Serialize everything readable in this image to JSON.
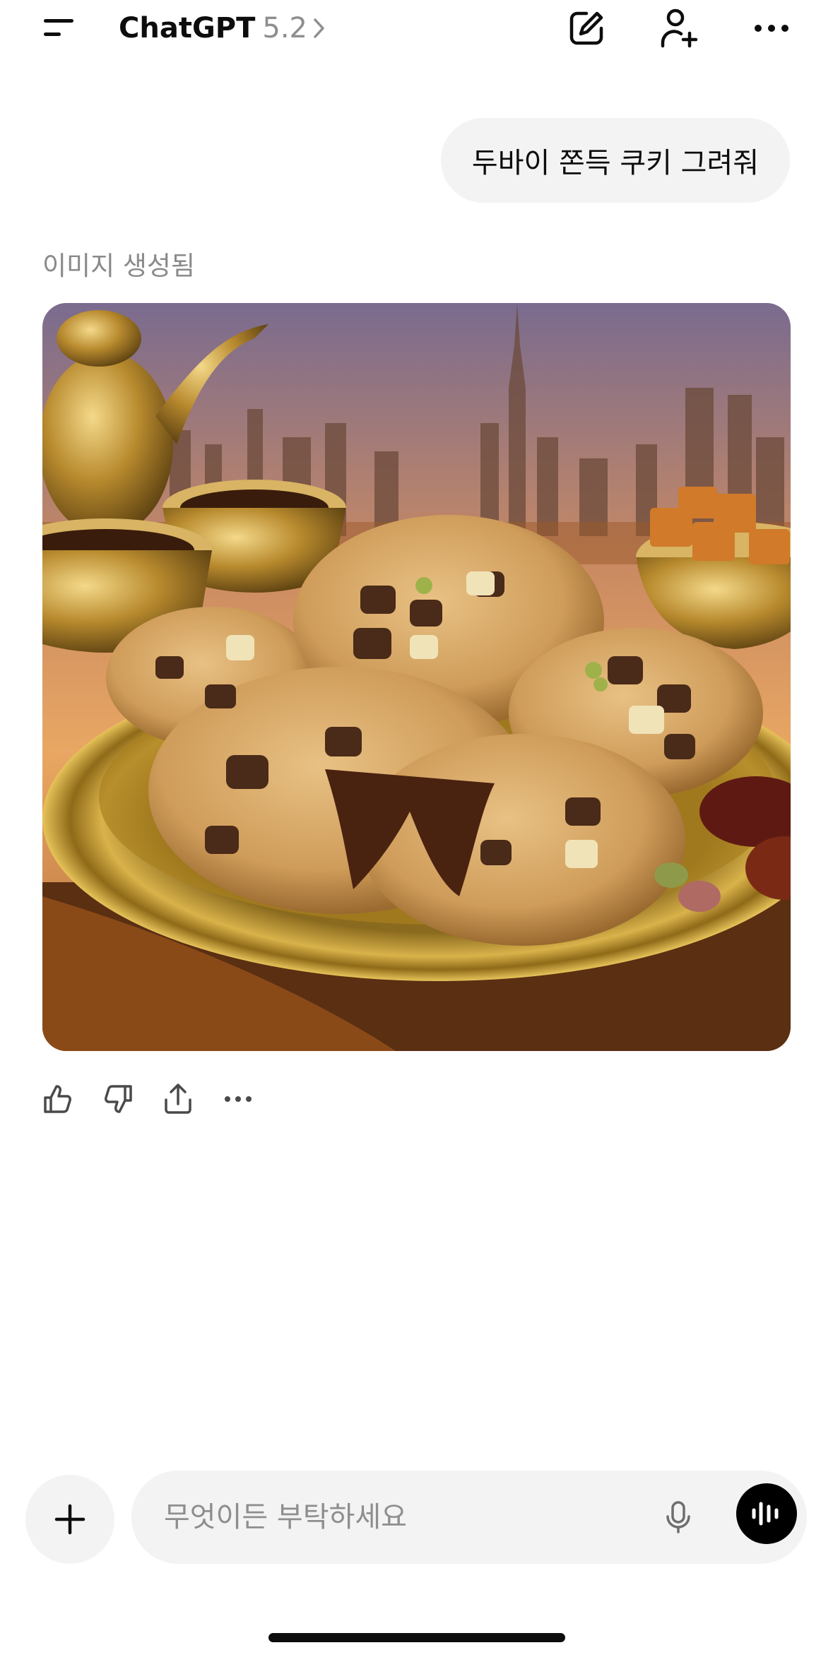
{
  "header": {
    "app_name": "ChatGPT",
    "model_version": "5.2",
    "icons": [
      "menu-icon",
      "chevron-right-icon",
      "new-chat-icon",
      "add-user-icon",
      "more-icon"
    ]
  },
  "conversation": {
    "user_message": "두바이 쫀득 쿠키 그려줘",
    "assistant_label": "이미지 생성됨",
    "image_description_icon": "generated-image"
  },
  "actions": {
    "icons": [
      "thumbs-up-icon",
      "thumbs-down-icon",
      "share-icon",
      "more-icon"
    ]
  },
  "composer": {
    "placeholder": "무엇이든 부탁하세요",
    "value": "",
    "icons": [
      "plus-icon",
      "mic-icon",
      "voice-mode-icon"
    ]
  },
  "colors": {
    "background": "#ffffff",
    "bubble": "#f3f3f3",
    "text": "#0d0d0d",
    "muted": "#8e8e8e",
    "voice_button": "#000000"
  }
}
